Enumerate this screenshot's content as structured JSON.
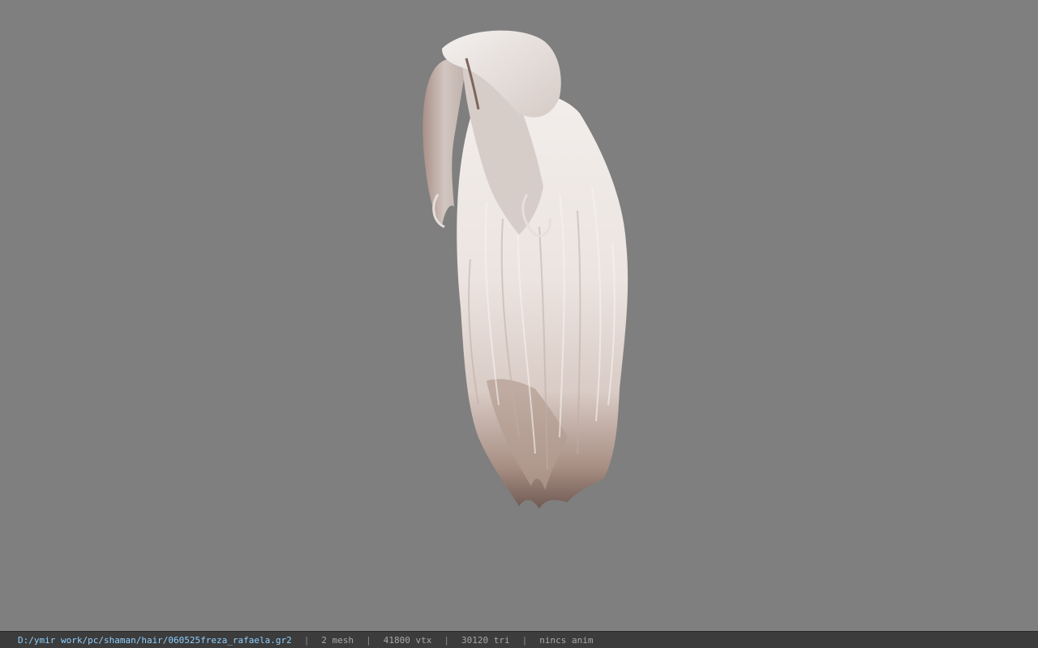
{
  "viewport": {
    "background_color": "#7f7f7f",
    "model": {
      "kind": "hair-mesh",
      "color_light": "#efe9e6",
      "color_mid": "#d8ccc7",
      "color_dark": "#8a7065"
    }
  },
  "statusbar": {
    "file_path": "D:/ymir work/pc/shaman/hair/060525freza_rafaela.gr2",
    "separator": "|",
    "mesh_count": "2 mesh",
    "vertex_count": "41800 vtx",
    "triangle_count": "30120 tri",
    "anim_status": "nincs anim",
    "path_color": "#8fd0ff",
    "text_color": "#a9a9a9",
    "background_color": "#3c3c3c"
  }
}
